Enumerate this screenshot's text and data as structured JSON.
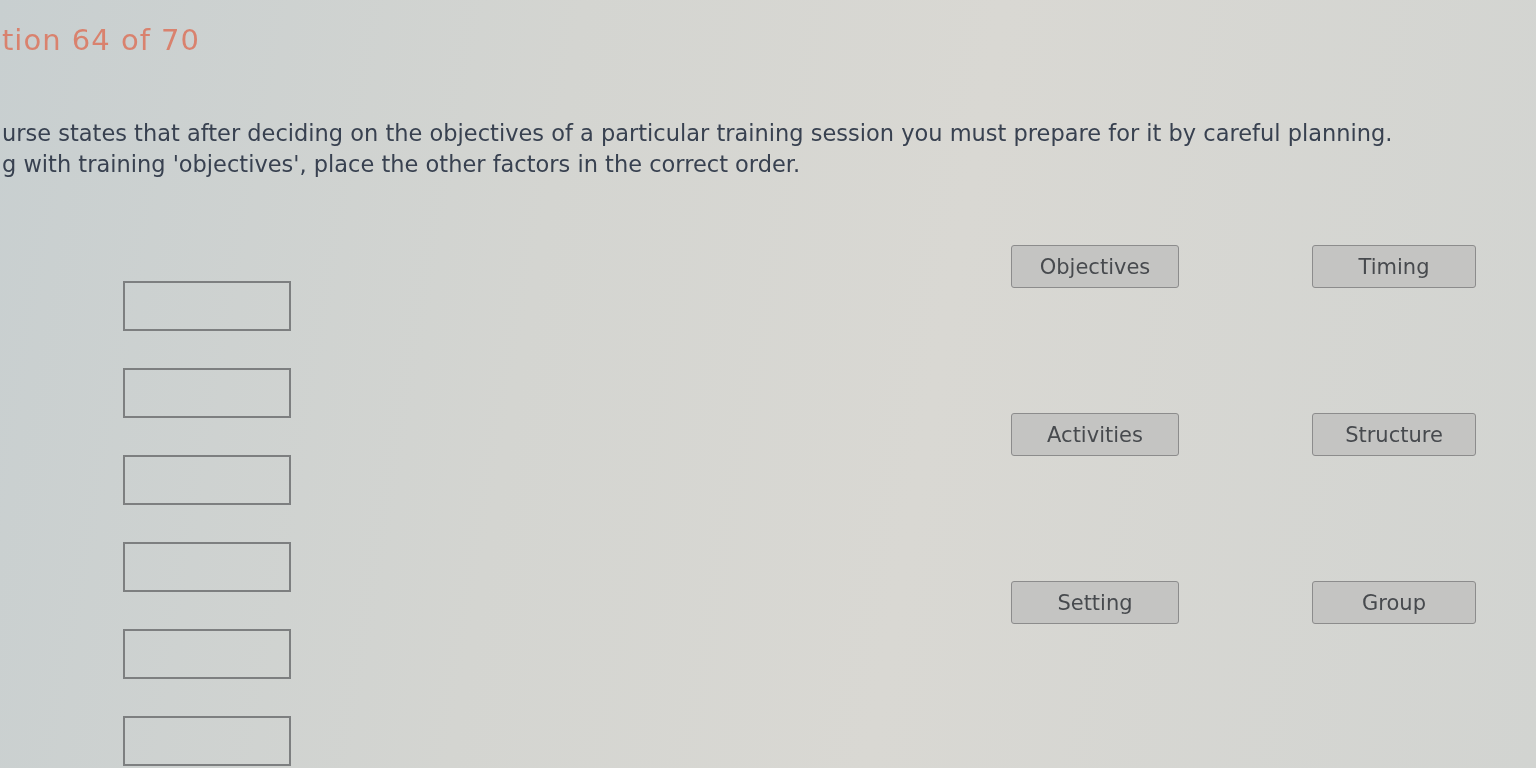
{
  "header": {
    "counter": "tion 64 of 70"
  },
  "instructions": [
    "urse states that after deciding on the objectives of a particular training session you must prepare for it by careful planning.",
    "g with training 'objectives', place the other factors in the correct order."
  ],
  "answer_slots": [
    {
      "filled": false
    },
    {
      "filled": false
    },
    {
      "filled": false
    },
    {
      "filled": false
    },
    {
      "filled": false
    },
    {
      "filled": false
    }
  ],
  "options": [
    {
      "label": "Objectives"
    },
    {
      "label": "Timing"
    },
    {
      "label": "Activities"
    },
    {
      "label": "Structure"
    },
    {
      "label": "Setting"
    },
    {
      "label": "Group"
    }
  ]
}
